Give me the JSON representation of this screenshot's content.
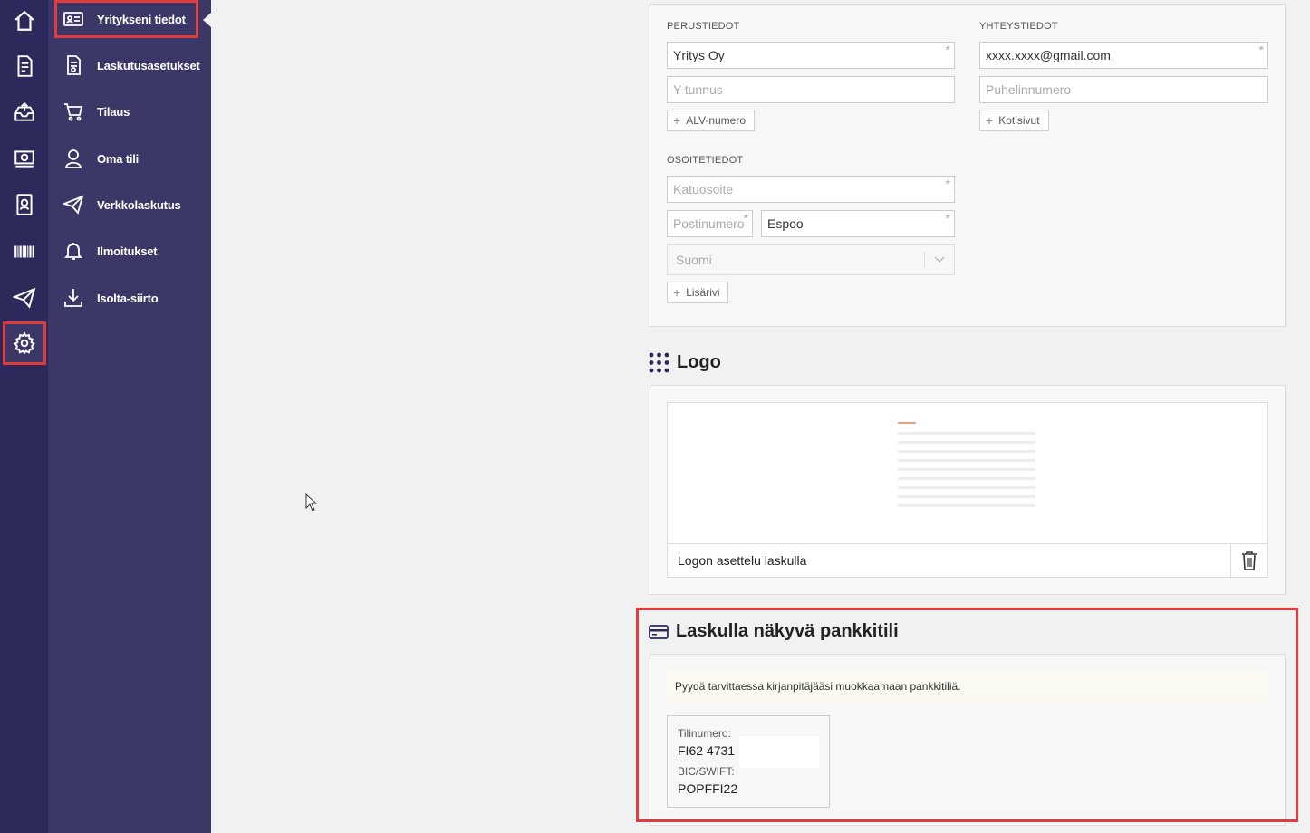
{
  "sidebar": {
    "subnav": [
      {
        "label": "Yritykseni tiedot"
      },
      {
        "label": "Laskutusasetukset"
      },
      {
        "label": "Tilaus"
      },
      {
        "label": "Oma tili"
      },
      {
        "label": "Verkkolaskutus"
      },
      {
        "label": "Ilmoitukset"
      },
      {
        "label": "Isolta-siirto"
      }
    ]
  },
  "form": {
    "perustiedot": {
      "title": "PERUSTIEDOT",
      "company_name": "Yritys Oy",
      "business_id_placeholder": "Y-tunnus",
      "add_vat_label": "ALV-numero"
    },
    "yhteystiedot": {
      "title": "YHTEYSTIEDOT",
      "email": "xxxx.xxxx@gmail.com",
      "phone_placeholder": "Puhelinnumero",
      "add_website_label": "Kotisivut"
    },
    "osoitetiedot": {
      "title": "OSOITETIEDOT",
      "street_placeholder": "Katuosoite",
      "postal_placeholder": "Postinumero",
      "city": "Espoo",
      "country": "Suomi",
      "add_line_label": "Lisärivi"
    },
    "required_mark": "*"
  },
  "logo": {
    "title": "Logo",
    "placement_label": "Logon asettelu laskulla"
  },
  "bank": {
    "title": "Laskulla näkyvä pankkitili",
    "notice": "Pyydä tarvittaessa kirjanpitäjääsi muokkaamaan pankkitiliä.",
    "account_label": "Tilinumero:",
    "account_value": "FI62 4731",
    "bic_label": "BIC/SWIFT:",
    "bic_value": "POPFFI22"
  },
  "colors": {
    "rail": "#2c2a5b",
    "subnav": "#3b3867",
    "highlight": "#e03c3c"
  }
}
